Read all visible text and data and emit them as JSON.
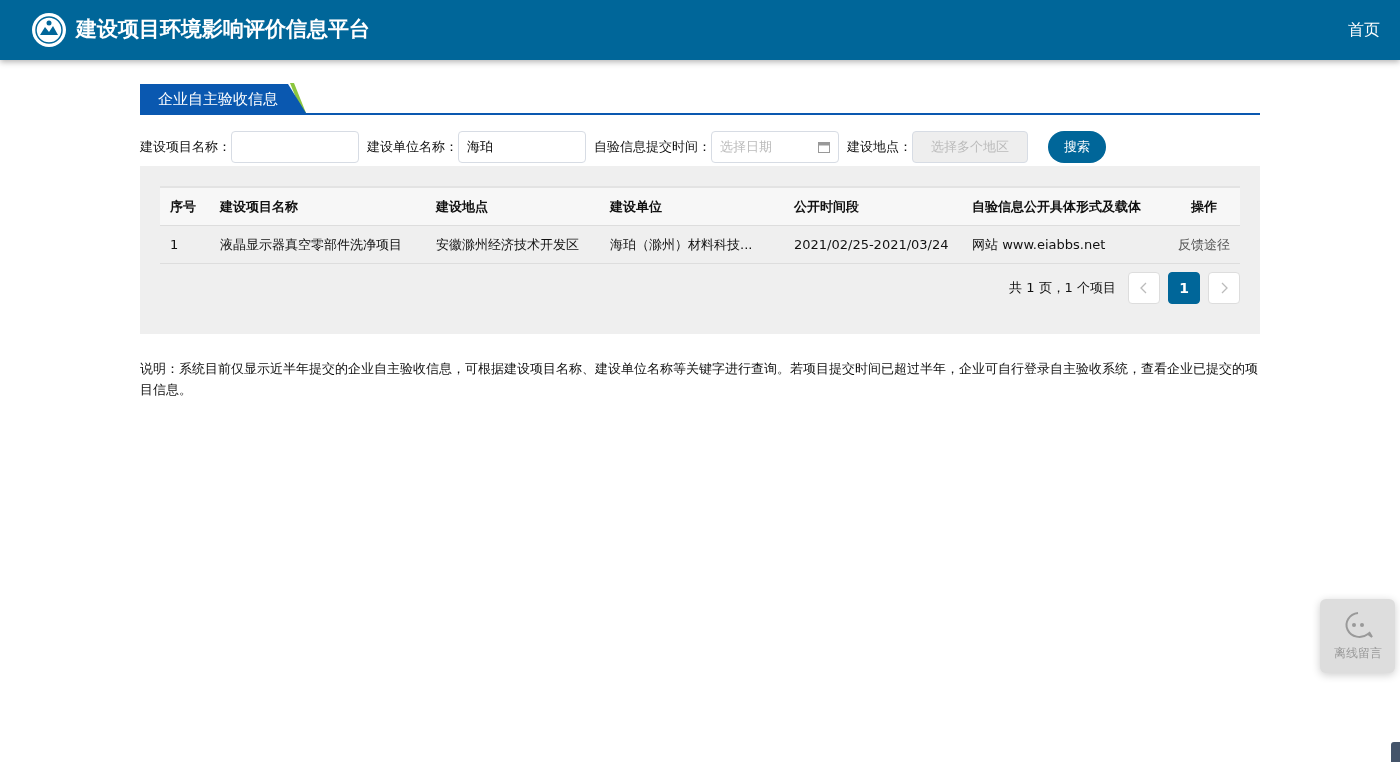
{
  "header": {
    "title": "建设项目环境影响评价信息平台",
    "nav": [
      {
        "label": "首页"
      }
    ]
  },
  "section_tab": "企业自主验收信息",
  "filters": [
    {
      "kind": "text",
      "label": "建设项目名称："
    },
    {
      "kind": "text",
      "label": "建设单位名称：",
      "value": "海珀"
    },
    {
      "kind": "date",
      "label": "自验信息提交时间：",
      "placeholder": "选择日期"
    },
    {
      "kind": "select",
      "label": "建设地点：",
      "placeholder": "选择多个地区",
      "disabled": true
    }
  ],
  "search_button": "搜索",
  "table": {
    "columns": [
      "序号",
      "建设项目名称",
      "建设地点",
      "建设单位",
      "公开时间段",
      "自验信息公开具体形式及载体",
      "操作"
    ],
    "rows": [
      {
        "cells": [
          "1",
          "液晶显示器真空零部件洗净项目",
          "安徽滁州经济技术开发区",
          "海珀（滁州）材料科技...",
          "2021/02/25-2021/03/24",
          "网站 www.eiabbs.net"
        ],
        "action": "反馈途径"
      }
    ]
  },
  "pagination": {
    "summary": "共 1 页，1 个项目",
    "pages": [
      {
        "label": "1",
        "selected": true
      }
    ]
  },
  "note": "说明：系统目前仅显示近半年提交的企业自主验收信息，可根据建设项目名称、建设单位名称等关键字进行查询。若项目提交时间已超过半年，企业可自行登录自主验收系统，查看企业已提交的项目信息。",
  "chat_widget": {
    "label": "离线留言"
  }
}
